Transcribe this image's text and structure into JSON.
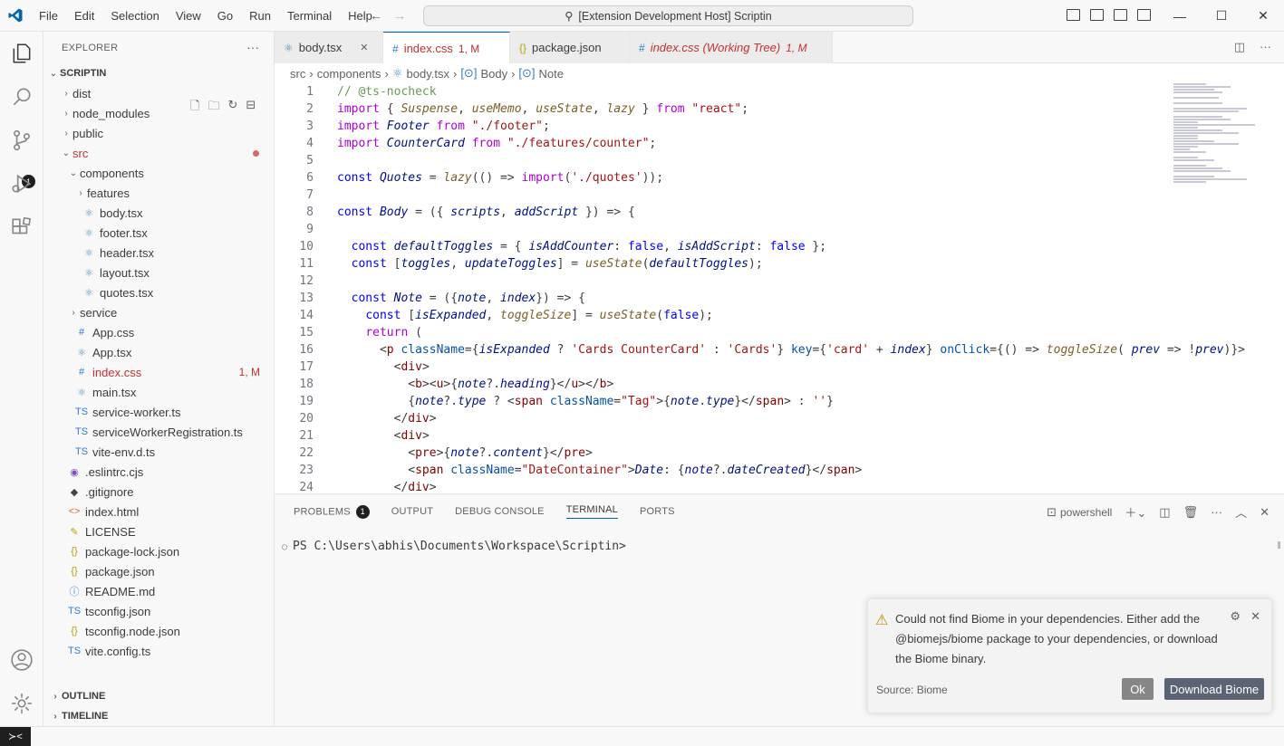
{
  "window": {
    "menu": [
      "File",
      "Edit",
      "Selection",
      "View",
      "Go",
      "Run",
      "Terminal",
      "Help"
    ],
    "command_center": "[Extension Development Host] Scriptin"
  },
  "activity": {
    "source_control_badge": "1"
  },
  "explorer": {
    "title": "EXPLORER",
    "root": "SCRIPTIN",
    "items": [
      {
        "label": "dist",
        "kind": "folder",
        "depth": 1,
        "expanded": false
      },
      {
        "label": "node_modules",
        "kind": "folder",
        "depth": 1,
        "expanded": false
      },
      {
        "label": "public",
        "kind": "folder",
        "depth": 1,
        "expanded": false
      },
      {
        "label": "src",
        "kind": "folder",
        "depth": 1,
        "expanded": true,
        "modified": true
      },
      {
        "label": "components",
        "kind": "folder",
        "depth": 2,
        "expanded": true
      },
      {
        "label": "features",
        "kind": "folder",
        "depth": 3,
        "expanded": false
      },
      {
        "label": "body.tsx",
        "kind": "react",
        "depth": 3
      },
      {
        "label": "footer.tsx",
        "kind": "react",
        "depth": 3
      },
      {
        "label": "header.tsx",
        "kind": "react",
        "depth": 3
      },
      {
        "label": "layout.tsx",
        "kind": "react",
        "depth": 3
      },
      {
        "label": "quotes.tsx",
        "kind": "react",
        "depth": 3
      },
      {
        "label": "service",
        "kind": "folder",
        "depth": 2,
        "expanded": false
      },
      {
        "label": "App.css",
        "kind": "css",
        "depth": 2
      },
      {
        "label": "App.tsx",
        "kind": "react",
        "depth": 2
      },
      {
        "label": "index.css",
        "kind": "css",
        "depth": 2,
        "modified": true,
        "tag": "1, M"
      },
      {
        "label": "main.tsx",
        "kind": "react",
        "depth": 2
      },
      {
        "label": "service-worker.ts",
        "kind": "ts",
        "depth": 2
      },
      {
        "label": "serviceWorkerRegistration.ts",
        "kind": "ts",
        "depth": 2
      },
      {
        "label": "vite-env.d.ts",
        "kind": "ts",
        "depth": 2
      },
      {
        "label": ".eslintrc.cjs",
        "kind": "eslint",
        "depth": 1
      },
      {
        "label": ".gitignore",
        "kind": "git",
        "depth": 1
      },
      {
        "label": "index.html",
        "kind": "html",
        "depth": 1
      },
      {
        "label": "LICENSE",
        "kind": "license",
        "depth": 1
      },
      {
        "label": "package-lock.json",
        "kind": "json",
        "depth": 1
      },
      {
        "label": "package.json",
        "kind": "json",
        "depth": 1
      },
      {
        "label": "README.md",
        "kind": "info",
        "depth": 1
      },
      {
        "label": "tsconfig.json",
        "kind": "tsconfig",
        "depth": 1
      },
      {
        "label": "tsconfig.node.json",
        "kind": "json",
        "depth": 1
      },
      {
        "label": "vite.config.ts",
        "kind": "ts",
        "depth": 1
      }
    ],
    "outline": "OUTLINE",
    "timeline": "TIMELINE"
  },
  "tabs": [
    {
      "label": "body.tsx",
      "icon": "react",
      "close": "✕"
    },
    {
      "label": "index.css",
      "icon": "#",
      "tag": "1, M",
      "active": true
    },
    {
      "label": "package.json",
      "icon": "{}"
    },
    {
      "label": "index.css (Working Tree)",
      "icon": "#",
      "tag": "1, M",
      "italic": true
    }
  ],
  "breadcrumbs": [
    "src",
    "components",
    "body.tsx",
    "Body",
    "Note"
  ],
  "code": [
    "// @ts-nocheck",
    "import { Suspense, useMemo, useState, lazy } from \"react\";",
    "import Footer from \"./footer\";",
    "import CounterCard from \"./features/counter\";",
    "",
    "const Quotes = lazy(() => import('./quotes'));",
    "",
    "const Body = ({ scripts, addScript }) => {",
    "",
    "  const defaultToggles = { isAddCounter: false, isAddScript: false };",
    "  const [toggles, updateToggles] = useState(defaultToggles);",
    "",
    "  const Note = ({note, index}) => {",
    "    const [isExpanded, toggleSize] = useState(false);",
    "    return (",
    "      <p className={isExpanded ? 'Cards CounterCard' : 'Cards'} key={'card' + index} onClick={() => toggleSize( prev => !prev)}>",
    "        <div>",
    "          <b><u>{note?.heading}</u></b>",
    "          {note?.type ? <span className=\"Tag\">{note.type}</span> : ''}",
    "        </div>",
    "        <div>",
    "          <pre>{note?.content}</pre>",
    "          <span className=\"DateContainer\">Date: {note?.dateCreated}</span>",
    "        </div>"
  ],
  "panel": {
    "tabs": [
      "PROBLEMS",
      "OUTPUT",
      "DEBUG CONSOLE",
      "TERMINAL",
      "PORTS"
    ],
    "problems_badge": "1",
    "active_tab": "TERMINAL",
    "shell": "powershell",
    "prompt": "PS C:\\Users\\abhis\\Documents\\Workspace\\Scriptin>"
  },
  "notification": {
    "message": "Could not find Biome in your dependencies. Either add the @biomejs/biome package to your dependencies, or download the Biome binary.",
    "source": "Source: Biome",
    "ok": "Ok",
    "download": "Download Biome"
  },
  "colors": {
    "accent": "#005fb8",
    "modified": "#c53030",
    "keyword": "#0000ff",
    "string": "#a31515"
  }
}
